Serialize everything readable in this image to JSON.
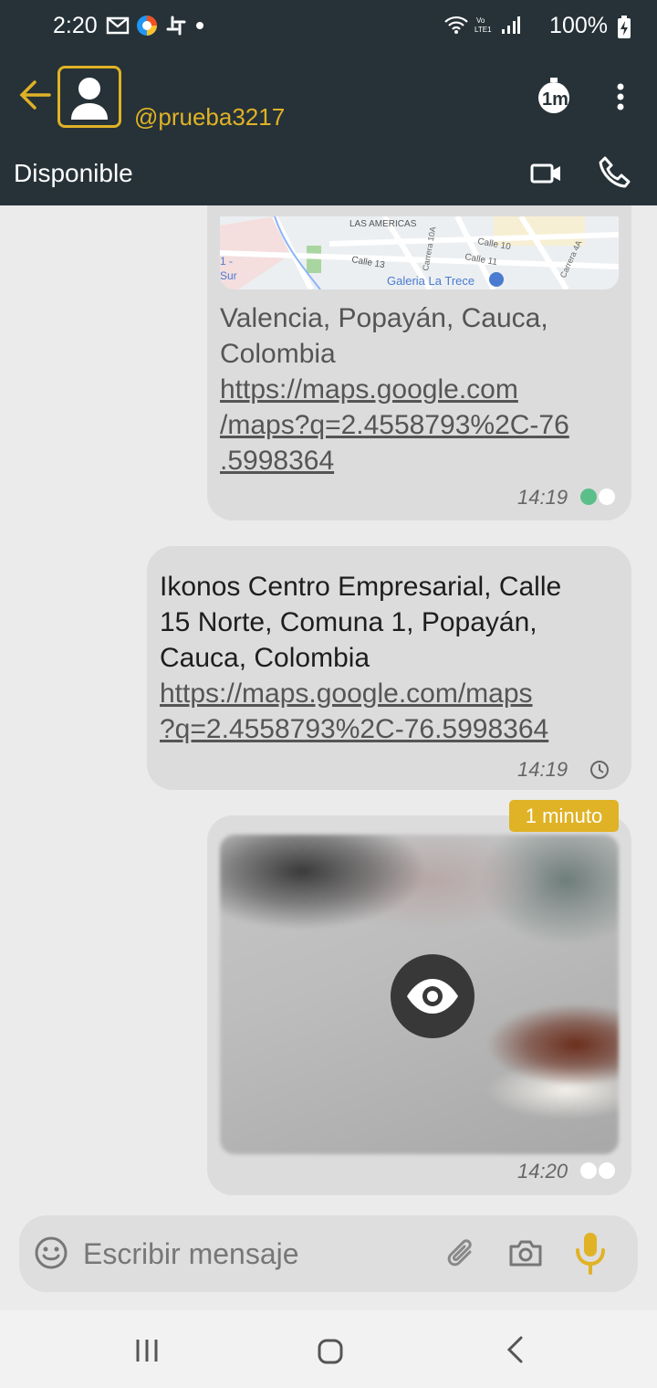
{
  "status_bar": {
    "time": "2:20",
    "battery": "100%",
    "icons": [
      "gmail-icon",
      "browser-icon",
      "slack-icon",
      "dot-icon",
      "wifi-icon",
      "volte-icon",
      "signal-icon",
      "battery-charging-icon"
    ]
  },
  "header": {
    "contact_name": "@prueba3217",
    "status": "Disponible",
    "accent_color": "#e0b225",
    "background_color": "#263238"
  },
  "map": {
    "labels": [
      "LAS AMERICAS",
      "Calle 10",
      "Calle 11",
      "Calle 13",
      "Carrera 10A",
      "Carrera 4A",
      "1 -",
      "Sur",
      "Galeria La Trece"
    ]
  },
  "messages": [
    {
      "text": "Valencia, Popayán, Cauca, Colombia",
      "link_lines": [
        "https://maps.google.com",
        "/maps?q=2.4558793%2C-76",
        ".5998364"
      ],
      "time": "14:19",
      "status": "read"
    },
    {
      "text_lines": [
        "Ikonos Centro Empresarial, Calle",
        "15 Norte, Comuna 1, Popayán,",
        "Cauca, Colombia"
      ],
      "link_lines": [
        "https://maps.google.com/maps",
        "?q=2.4558793%2C-76.5998364"
      ],
      "time": "14:19",
      "status": "pending"
    },
    {
      "badge": "1 minuto",
      "time": "14:20",
      "status": "sent"
    }
  ],
  "input": {
    "placeholder": "Escribir mensaje"
  }
}
